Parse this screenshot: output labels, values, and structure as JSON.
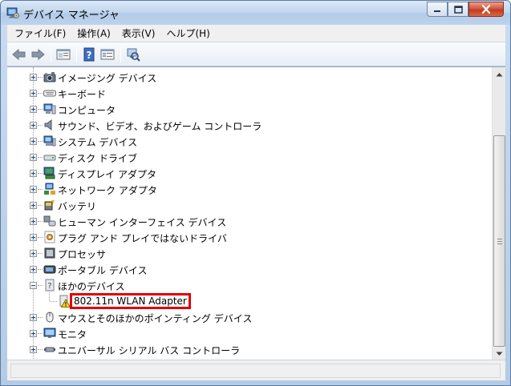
{
  "window": {
    "title": "デバイス マネージャ",
    "accent": "#b4cbe6"
  },
  "menu": [
    "ファイル(F)",
    "操作(A)",
    "表示(V)",
    "ヘルプ(H)"
  ],
  "toolbar": {
    "icons": [
      "back-arrow-icon",
      "forward-arrow-icon",
      "show-hide-tree-icon",
      "help-icon",
      "properties-icon",
      "scan-hardware-icon"
    ]
  },
  "tree": {
    "items": [
      {
        "label": "イメージング デバイス",
        "icon": "camera-icon",
        "expanded": false
      },
      {
        "label": "キーボード",
        "icon": "keyboard-icon",
        "expanded": false
      },
      {
        "label": "コンピュータ",
        "icon": "computer-icon",
        "expanded": false
      },
      {
        "label": "サウンド、ビデオ、およびゲーム コントローラ",
        "icon": "speaker-icon",
        "expanded": false
      },
      {
        "label": "システム デバイス",
        "icon": "system-device-icon",
        "expanded": false
      },
      {
        "label": "ディスク ドライブ",
        "icon": "disk-drive-icon",
        "expanded": false
      },
      {
        "label": "ディスプレイ アダプタ",
        "icon": "display-adapter-icon",
        "expanded": false
      },
      {
        "label": "ネットワーク アダプタ",
        "icon": "network-adapter-icon",
        "expanded": false
      },
      {
        "label": "バッテリ",
        "icon": "battery-icon",
        "expanded": false
      },
      {
        "label": "ヒューマン インターフェイス デバイス",
        "icon": "hid-icon",
        "expanded": false
      },
      {
        "label": "プラグ アンド プレイではないドライバ",
        "icon": "driver-icon",
        "expanded": false
      },
      {
        "label": "プロセッサ",
        "icon": "processor-icon",
        "expanded": false
      },
      {
        "label": "ポータブル デバイス",
        "icon": "portable-device-icon",
        "expanded": false
      },
      {
        "label": "ほかのデバイス",
        "icon": "unknown-device-icon",
        "expanded": true
      },
      {
        "label": "マウスとそのほかのポインティング デバイス",
        "icon": "mouse-icon",
        "expanded": false
      },
      {
        "label": "モニタ",
        "icon": "monitor-icon",
        "expanded": false
      },
      {
        "label": "ユニバーサル シリアル バス コントローラ",
        "icon": "usb-icon",
        "expanded": false
      }
    ],
    "child": {
      "label": "802.11n WLAN Adapter",
      "icon": "warning-device-icon",
      "highlight_color": "#e00000"
    }
  }
}
